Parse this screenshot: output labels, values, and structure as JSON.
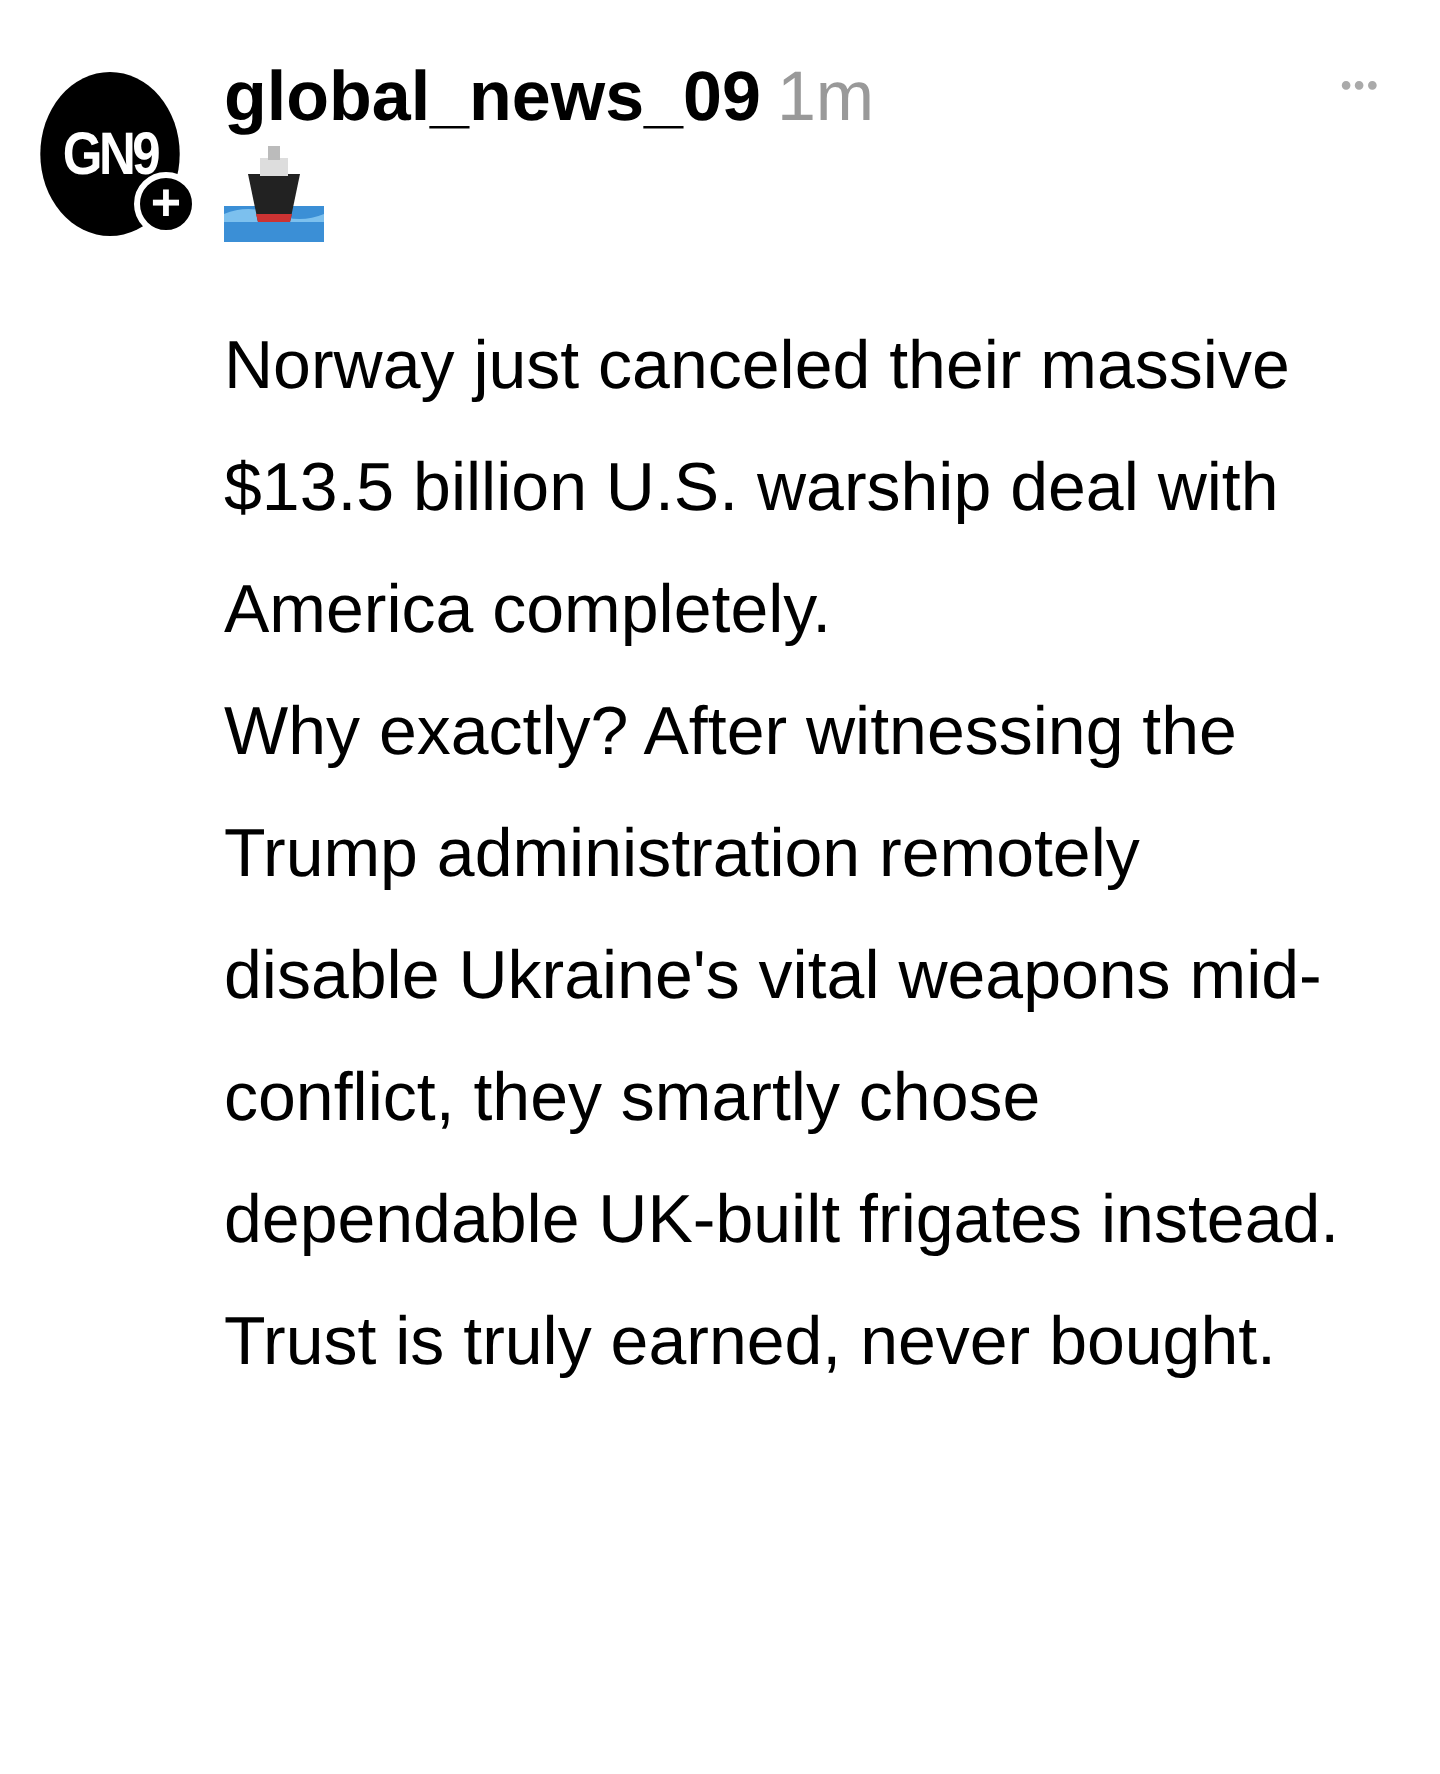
{
  "post": {
    "avatar": {
      "label": "GN9",
      "follow_badge": "+"
    },
    "username": "global_news_09",
    "time": "1m",
    "more": "•••",
    "paragraphs": [
      "Norway just canceled their massive $13.5 billion U.S. warship deal with America completely.",
      "Why exactly? After witnessing the Trump administration remotely disable Ukraine's vital weapons mid-conflict, they smartly chose dependable UK-built frigates instead.",
      "Trust is truly earned, never bought."
    ]
  }
}
